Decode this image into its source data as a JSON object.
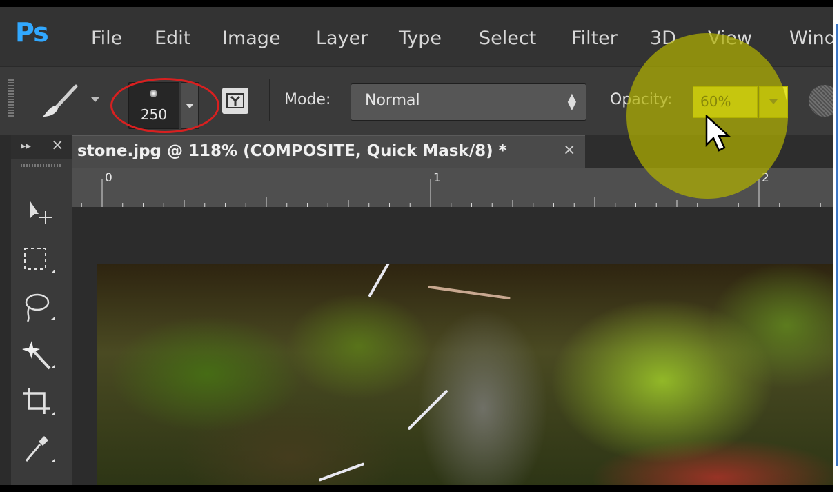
{
  "app": {
    "logo": "Ps",
    "accent_color": "#31a8ff"
  },
  "menu": [
    "File",
    "Edit",
    "Image",
    "Layer",
    "Type",
    "Select",
    "Filter",
    "3D",
    "View",
    "Wind"
  ],
  "options_bar": {
    "tool_icon": "brush-icon",
    "brush_size": "250",
    "mode_label": "Mode:",
    "mode_value": "Normal",
    "opacity_label": "Opacity:",
    "opacity_value": "60%",
    "highlight_color": "#d82020",
    "spotlight_color": "#b0b000"
  },
  "tools_panel": {
    "expand_glyph": "▸▸",
    "close_glyph": "×",
    "tools": [
      "move-tool",
      "marquee-tool",
      "lasso-tool",
      "magic-wand-tool",
      "crop-tool",
      "eyedropper-tool"
    ]
  },
  "document": {
    "tab_title": "stone.jpg @ 118% (COMPOSITE, Quick Mask/8) *",
    "close_glyph": "×"
  },
  "ruler": {
    "labels": [
      "0",
      "1",
      "2"
    ]
  }
}
